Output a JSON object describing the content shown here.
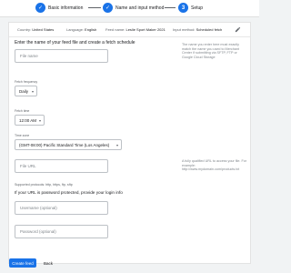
{
  "stepper": {
    "steps": [
      {
        "label": "Basic information",
        "state": "done"
      },
      {
        "label": "Name and input method",
        "state": "done"
      },
      {
        "label": "Setup",
        "state": "current",
        "number": "3"
      }
    ]
  },
  "summary": {
    "country_label": "Country:",
    "country_value": "United States",
    "language_label": "Language:",
    "language_value": "English",
    "feed_name_label": "Feed name:",
    "feed_name_value": "Leslie Sport Maker 2021",
    "input_method_label": "Input method:",
    "input_method_value": "Scheduled fetch"
  },
  "form": {
    "heading": "Enter the name of your feed file and create a fetch schedule",
    "file_name_placeholder": "File name",
    "file_name_help": "The name you enter here must exactly match the name you used to Merchant Center if submitting via SFTP, FTP or Google Cloud Storage",
    "fetch_frequency_label": "Fetch frequency",
    "fetch_frequency_value": "Daily",
    "fetch_time_label": "Fetch time",
    "fetch_time_value": "12:00 AM",
    "time_zone_label": "Time zone",
    "time_zone_value": "(GMT-08:00) Pacific Standard Time (Los Angeles)",
    "file_url_placeholder": "File URL",
    "file_url_help": "A fully qualified URL to access your file. For example:",
    "file_url_example": "http://www.mydomain.com/products.txt",
    "protocols_note": "Supported protocols: http, https, ftp, sftp",
    "password_heading": "If your URL is password protected, provide your login info",
    "username_placeholder": "Username (optional)",
    "password_placeholder": "Password (optional)"
  },
  "actions": {
    "create_label": "Create feed",
    "back_label": "Back"
  },
  "colors": {
    "accent": "#1a73e8",
    "page_bg": "#f1f3f4",
    "card_bg": "#ffffff"
  }
}
